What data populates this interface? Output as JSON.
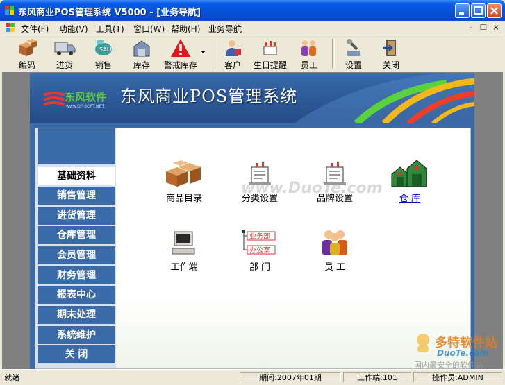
{
  "window": {
    "title": "东风商业POS管理系统 V5000 - [业务导航]"
  },
  "menu": [
    "文件(F)",
    "功能(V)",
    "工具(T)",
    "窗口(W)",
    "帮助(H)",
    "业务导航"
  ],
  "toolbar": [
    {
      "label": "编码",
      "icon": "boxes-icon"
    },
    {
      "label": "进货",
      "icon": "truck-icon"
    },
    {
      "label": "销售",
      "icon": "sale-icon"
    },
    {
      "label": "库存",
      "icon": "warehouse-icon"
    },
    {
      "label": "警戒库存",
      "icon": "warning-icon"
    },
    {
      "label": "客户",
      "icon": "customer-icon"
    },
    {
      "label": "生日提醒",
      "icon": "birthday-icon"
    },
    {
      "label": "员工",
      "icon": "staff-icon"
    },
    {
      "label": "设置",
      "icon": "settings-icon"
    },
    {
      "label": "关闭",
      "icon": "exit-icon"
    }
  ],
  "banner": {
    "system_title": "东风商业POS管理系统",
    "logo_text": "东风软件",
    "logo_sub": "www.DF-SOFT.NET"
  },
  "nav": [
    {
      "label": "基础资料",
      "active": true
    },
    {
      "label": "销售管理"
    },
    {
      "label": "进货管理"
    },
    {
      "label": "仓库管理"
    },
    {
      "label": "会员管理"
    },
    {
      "label": "财务管理"
    },
    {
      "label": "报表中心"
    },
    {
      "label": "期末处理"
    },
    {
      "label": "系统维护"
    },
    {
      "label": "关    闭"
    }
  ],
  "items": [
    {
      "label": "商品目录",
      "icon": "boxes-icon"
    },
    {
      "label": "分类设置",
      "icon": "category-icon"
    },
    {
      "label": "品牌设置",
      "icon": "brand-icon"
    },
    {
      "label": "仓  库",
      "icon": "warehouse-icon",
      "link": true
    },
    {
      "label": "工作端",
      "icon": "computer-icon"
    },
    {
      "label": "部  门",
      "icon": "department-icon",
      "dept_tags": [
        "业务部",
        "办公室"
      ]
    },
    {
      "label": "员  工",
      "icon": "staff-icon"
    }
  ],
  "watermark": "www.DuoTe.com",
  "status": {
    "ready": "就绪",
    "period": "期间:2007年01期",
    "workstation": "工作端:101",
    "operator": "操作员:ADMIN"
  },
  "corner_watermark": {
    "brand": "多特软件站",
    "site": "DuoTe.com",
    "slogan": "国内最安全的软件站"
  },
  "colors": {
    "titlebar": "#0a5ce8",
    "nav_bg": "#3a6aa8",
    "link": "#0000cc"
  }
}
